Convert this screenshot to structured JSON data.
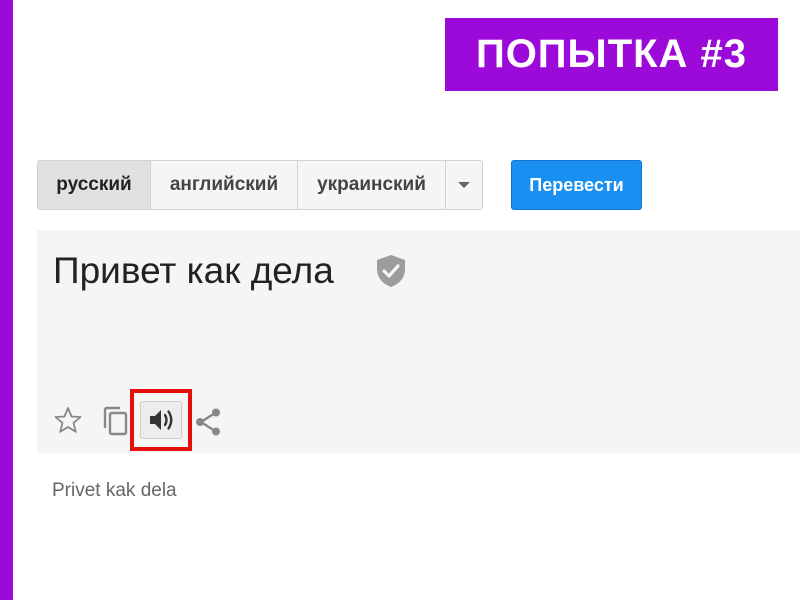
{
  "badge": {
    "text": "ПОПЫТКА #3"
  },
  "colors": {
    "accent": "#9b0ad8",
    "translate_button": "#1a8ff2",
    "highlight": "#e60d0d"
  },
  "language_tabs": [
    {
      "label": "русский",
      "active": true
    },
    {
      "label": "английский",
      "active": false
    },
    {
      "label": "украинский",
      "active": false
    }
  ],
  "language_more_icon": "chevron-down-icon",
  "translate_button": {
    "label": "Перевести"
  },
  "source": {
    "text": "Привет как дела",
    "verified_icon": "shield-check-icon"
  },
  "toolbar": {
    "icons": [
      "star-icon",
      "copy-icon",
      "speaker-icon",
      "share-icon"
    ],
    "highlighted": "speaker-icon"
  },
  "transliteration": "Privet kak dela"
}
